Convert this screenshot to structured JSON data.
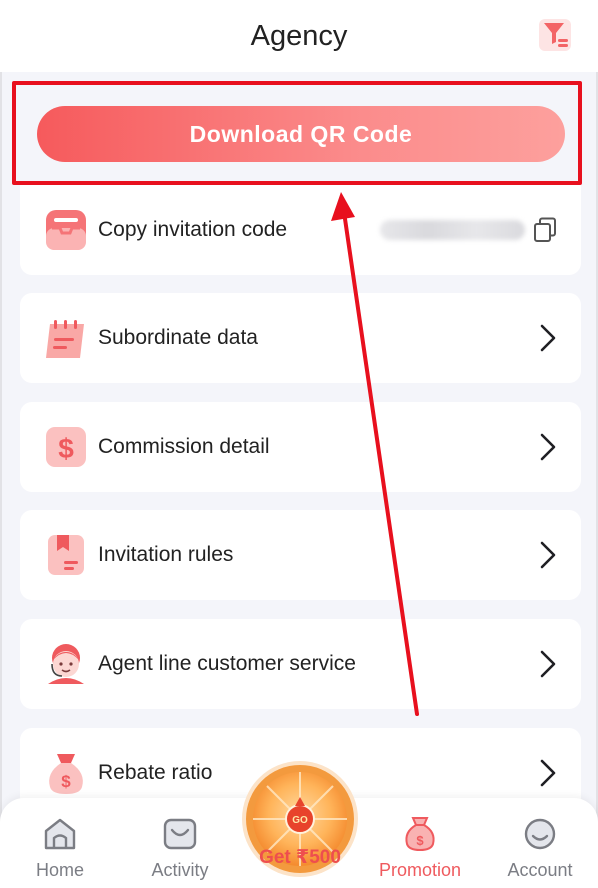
{
  "header": {
    "title": "Agency",
    "filter_icon": "filter-icon"
  },
  "qr_button": {
    "label": "Download QR Code",
    "highlight_color": "#e8101e"
  },
  "menu": {
    "copy_invite": {
      "label": "Copy invitation code",
      "icon": "inbox-tray-icon"
    },
    "items": [
      {
        "label": "Subordinate data",
        "icon": "calendar-list-icon"
      },
      {
        "label": "Commission detail",
        "icon": "dollar-icon"
      },
      {
        "label": "Invitation rules",
        "icon": "bookmark-doc-icon"
      },
      {
        "label": "Agent line customer service",
        "icon": "agent-headset-icon"
      },
      {
        "label": "Rebate ratio",
        "icon": "money-bag-icon"
      }
    ]
  },
  "bottom_nav": {
    "items": [
      {
        "label": "Home",
        "icon": "home-icon"
      },
      {
        "label": "Activity",
        "icon": "gift-box-icon"
      },
      {
        "label": "Promotion",
        "icon": "money-bag-icon",
        "active": true
      },
      {
        "label": "Account",
        "icon": "smile-face-icon"
      }
    ],
    "wheel": {
      "go_label": "GO",
      "label": "Get ₹500"
    }
  },
  "colors": {
    "accent": "#f65a5c",
    "active_nav": "#ef5a5e",
    "annotation": "#e8101e"
  }
}
